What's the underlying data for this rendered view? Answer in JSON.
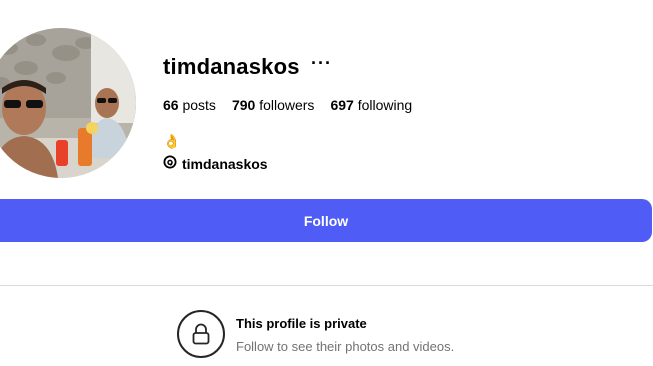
{
  "profile": {
    "username": "timdanaskos",
    "more_icon": "ellipsis-icon",
    "stats": {
      "posts_count": "66",
      "posts_label": "posts",
      "followers_count": "790",
      "followers_label": "followers",
      "following_count": "697",
      "following_label": "following"
    },
    "bio_emoji": "👌",
    "threads_icon": "threads-icon",
    "threads_handle": "timdanaskos"
  },
  "actions": {
    "follow_label": "Follow",
    "follow_color": "#4f5cf6"
  },
  "private": {
    "icon": "lock-icon",
    "title": "This profile is private",
    "subtitle": "Follow to see their photos and videos."
  }
}
